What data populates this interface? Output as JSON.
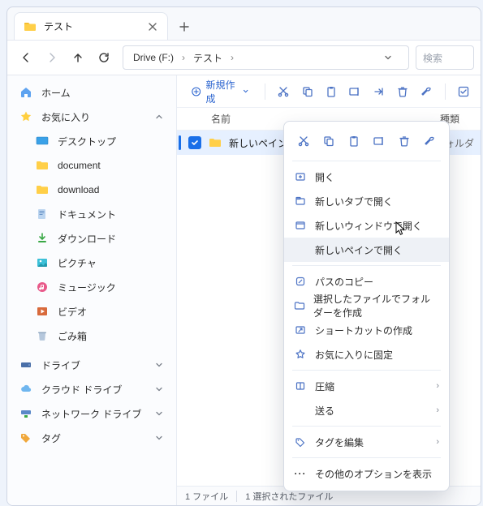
{
  "tab": {
    "title": "テスト",
    "new_tab": "+"
  },
  "path": {
    "drive": "Drive (F:)",
    "folder": "テスト"
  },
  "search": {
    "placeholder": "検索"
  },
  "toolbar": {
    "new_label": "新規作成"
  },
  "sidebar": {
    "home": "ホーム",
    "favorites": "お気に入り",
    "items": [
      {
        "label": "デスクトップ"
      },
      {
        "label": "document"
      },
      {
        "label": "download"
      },
      {
        "label": "ドキュメント"
      },
      {
        "label": "ダウンロード"
      },
      {
        "label": "ピクチャ"
      },
      {
        "label": "ミュージック"
      },
      {
        "label": "ビデオ"
      },
      {
        "label": "ごみ箱"
      }
    ],
    "drives": "ドライブ",
    "cloud": "クラウド ドライブ",
    "network": "ネットワーク ドライブ",
    "tags": "タグ"
  },
  "columns": {
    "name": "名前",
    "type": "種類"
  },
  "rows": [
    {
      "name": "新しいペイン",
      "type": "フォルダ"
    }
  ],
  "context": {
    "open": "開く",
    "open_new_tab": "新しいタブで開く",
    "open_new_window": "新しいウィンドウで開く",
    "open_new_pane": "新しいペインで開く",
    "copy_path": "パスのコピー",
    "create_folder_with_selection": "選択したファイルでフォルダーを作成",
    "create_shortcut": "ショートカットの作成",
    "pin_favorites": "お気に入りに固定",
    "compress": "圧縮",
    "send_to": "送る",
    "edit_tags": "タグを編集",
    "more_options": "その他のオプションを表示"
  },
  "status": {
    "count": "1 ファイル",
    "selected": "1 選択されたファイル"
  }
}
